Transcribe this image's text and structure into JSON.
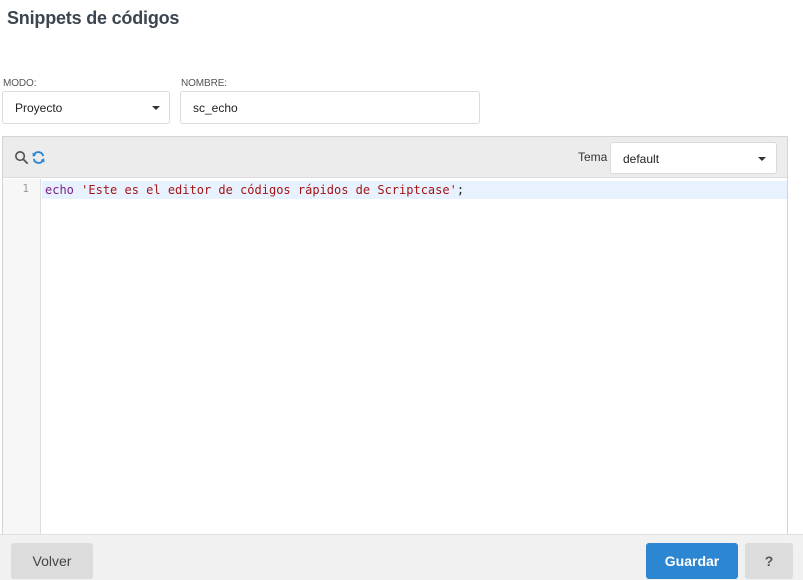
{
  "page": {
    "title": "Snippets de códigos"
  },
  "form": {
    "modo_label": "MODO:",
    "modo_value": "Proyecto",
    "nombre_label": "NOMBRE:",
    "nombre_value": "sc_echo"
  },
  "editor": {
    "tema_label": "Tema",
    "tema_value": "default",
    "line_number": "1",
    "code": {
      "keyword": "echo",
      "space": " ",
      "string": "'Este es el editor de códigos rápidos de Scriptcase'",
      "terminator": ";"
    },
    "icons": {
      "search": "search-icon",
      "refresh": "refresh-icon"
    },
    "colors": {
      "keyword": "#7a1f86",
      "string": "#a31515",
      "active_line": "#e8f2ff"
    }
  },
  "footer": {
    "volver_label": "Volver",
    "guardar_label": "Guardar",
    "help_label": "?",
    "colors": {
      "primary": "#2c86d2"
    }
  }
}
